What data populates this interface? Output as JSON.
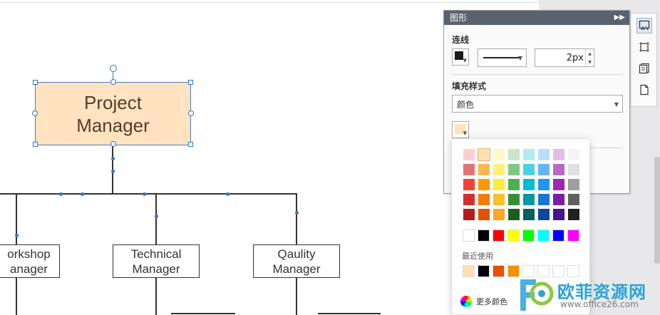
{
  "canvas": {
    "nodes": {
      "project_manager": [
        "Project",
        "Manager"
      ],
      "workshop": [
        "orkshop",
        "anager"
      ],
      "technical": [
        "Technical",
        "Manager"
      ],
      "quality": [
        "Qaulity",
        "Manager"
      ]
    }
  },
  "panel": {
    "title": "图形",
    "collapse_icon": "double-chevron-right",
    "line_section": {
      "title": "连线",
      "stroke_color": "#1a1a1a",
      "stroke_width": "2px"
    },
    "fill_section": {
      "title": "填充样式",
      "mode": "颜色",
      "fill_color": "#ffe3c0"
    }
  },
  "color_picker": {
    "top_row": [
      "#ffcdd2",
      "#ffe0b2",
      "#fff9c4",
      "#c8e6c9",
      "#b2ebf2",
      "#bbdefb",
      "#e1bee7",
      "#f5f5f5"
    ],
    "grid": [
      [
        "#e57373",
        "#ffb74d",
        "#fff176",
        "#81c784",
        "#4dd0e1",
        "#64b5f6",
        "#ba68c8",
        "#e0e0e0"
      ],
      [
        "#f44336",
        "#ff9800",
        "#ffeb3b",
        "#4caf50",
        "#00bcd4",
        "#2196f3",
        "#9c27b0",
        "#9e9e9e"
      ],
      [
        "#d32f2f",
        "#f57c00",
        "#fbc02d",
        "#388e3c",
        "#0097a7",
        "#1976d2",
        "#7b1fa2",
        "#616161"
      ],
      [
        "#b71c1c",
        "#e65100",
        "#f9a825",
        "#1b5e20",
        "#006064",
        "#0d47a1",
        "#4a148c",
        "#212121"
      ]
    ],
    "basic": [
      "#ffffff",
      "#000000",
      "#ff0000",
      "#ffff00",
      "#00ff00",
      "#00ffff",
      "#0000ff",
      "#ff00ff"
    ],
    "recent_label": "最近使用",
    "recent": [
      "#ffe0b2",
      "#000000",
      "#e65100",
      "#f59200",
      "#ffffff",
      "#ffffff",
      "#ffffff",
      "#ffffff"
    ],
    "more_label": "更多颜色"
  },
  "side_toolbar": [
    "shape-format-icon",
    "page-setup-icon",
    "copy-pages-icon",
    "document-icon"
  ],
  "watermark": {
    "brand": "欧菲资源网",
    "url": "www.office26.com"
  }
}
